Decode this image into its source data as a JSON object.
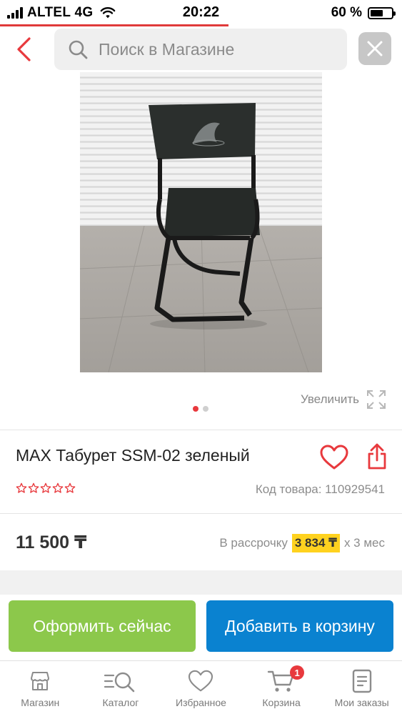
{
  "status_bar": {
    "carrier": "ALTEL 4G",
    "time": "20:22",
    "battery": "60 %",
    "battery_level": 0.6
  },
  "header": {
    "search_placeholder": "Поиск в Магазине",
    "back_icon": "chevron-left-icon",
    "search_icon": "search-icon",
    "close_icon": "close-icon"
  },
  "gallery": {
    "zoom_label": "Увеличить",
    "zoom_icon": "expand-icon",
    "image_count": 2,
    "active_index": 0
  },
  "product": {
    "title": "MAX Табурет SSM-02 зеленый",
    "rating_stars": 0,
    "rating_max": 5,
    "sku_label": "Код товара: 110929541",
    "price": "11 500 ₸",
    "installment_prefix": "В рассрочку",
    "installment_amount": "3 834 ₸",
    "installment_suffix": "х 3 мес"
  },
  "actions": {
    "order_now": "Оформить сейчас",
    "add_to_cart": "Добавить в корзину"
  },
  "tabbar": {
    "items": [
      {
        "label": "Магазин",
        "icon": "store-icon"
      },
      {
        "label": "Каталог",
        "icon": "catalog-search-icon"
      },
      {
        "label": "Избранное",
        "icon": "heart-icon"
      },
      {
        "label": "Корзина",
        "icon": "cart-icon",
        "badge": "1"
      },
      {
        "label": "Мои заказы",
        "icon": "orders-icon"
      }
    ]
  },
  "colors": {
    "accent_red": "#e8393d",
    "order_green": "#8cc84b",
    "cart_blue": "#0a82d0",
    "installment_yellow": "#ffd21f"
  }
}
